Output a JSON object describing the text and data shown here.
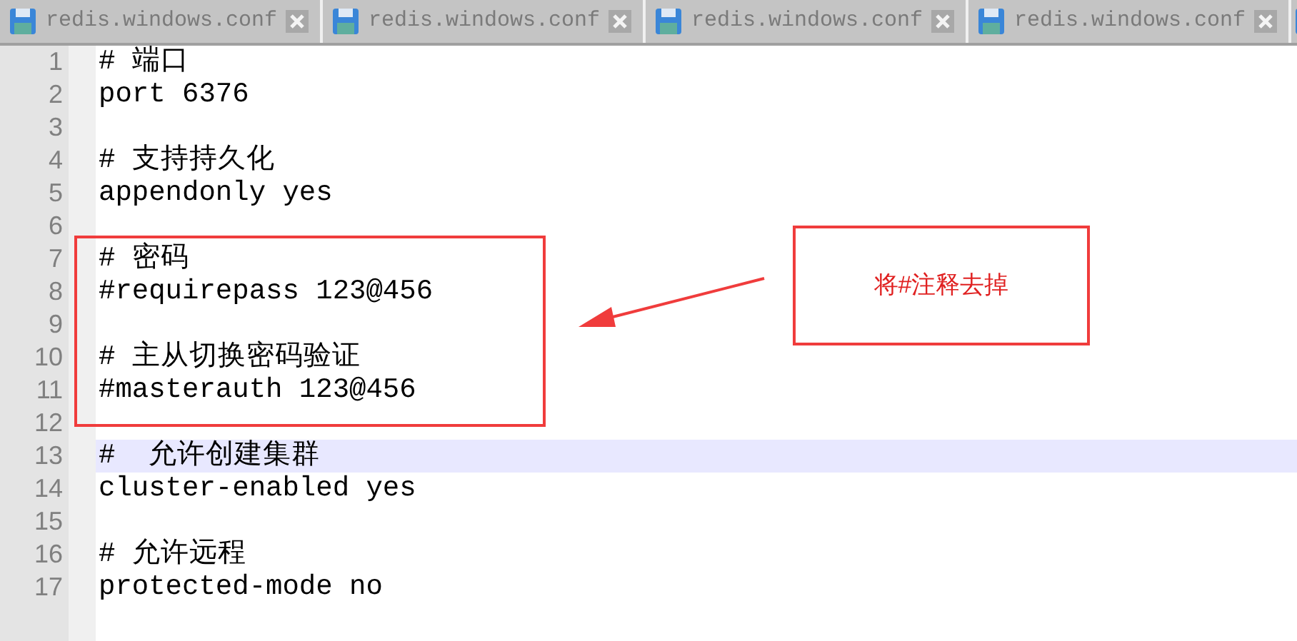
{
  "tabs": [
    {
      "label": "redis.windows.conf"
    },
    {
      "label": "redis.windows.conf"
    },
    {
      "label": "redis.windows.conf"
    },
    {
      "label": "redis.windows.conf"
    }
  ],
  "editor": {
    "lines": [
      {
        "number": "1",
        "text": "# 端口",
        "current": false
      },
      {
        "number": "2",
        "text": "port 6376",
        "current": false
      },
      {
        "number": "3",
        "current": false
      },
      {
        "number": "4",
        "text": "# 支持持久化",
        "current": false
      },
      {
        "number": "5",
        "text": "appendonly yes",
        "current": false
      },
      {
        "number": "6",
        "current": false
      },
      {
        "number": "7",
        "text": "# 密码",
        "current": false
      },
      {
        "number": "8",
        "text": "#requirepass 123@456",
        "current": false
      },
      {
        "number": "9",
        "current": false
      },
      {
        "number": "10",
        "text": "# 主从切换密码验证",
        "current": false
      },
      {
        "number": "11",
        "text": "#masterauth 123@456",
        "current": false
      },
      {
        "number": "12",
        "current": false
      },
      {
        "number": "13",
        "text": "#  允许创建集群",
        "current": true
      },
      {
        "number": "14",
        "text": "cluster-enabled yes",
        "current": false
      },
      {
        "number": "15",
        "current": false
      },
      {
        "number": "16",
        "text": "# 允许远程",
        "current": false
      },
      {
        "number": "17",
        "text": "protected-mode no",
        "current": false
      }
    ]
  },
  "annotation": {
    "callout": "将#注释去掉"
  }
}
